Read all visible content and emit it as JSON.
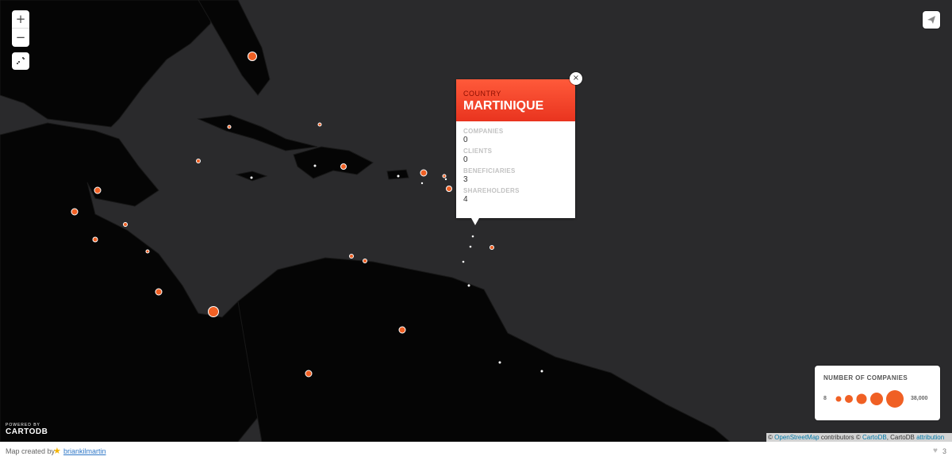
{
  "map": {
    "colors": {
      "ocean": "#2a2a2c",
      "land": "#050505",
      "marker": "#f06024",
      "marker_small": "#ffffff"
    }
  },
  "controls": {
    "zoom_in": "+",
    "zoom_out": "−",
    "fullscreen_icon": "fullscreen-icon",
    "share_icon": "share-icon"
  },
  "popup": {
    "title_label": "COUNTRY",
    "title_value": "MARTINIQUE",
    "close": "×",
    "rows": [
      {
        "label": "COMPANIES",
        "value": "0"
      },
      {
        "label": "CLIENTS",
        "value": "0"
      },
      {
        "label": "BENEFICIARIES",
        "value": "3"
      },
      {
        "label": "SHAREHOLDERS",
        "value": "4"
      }
    ]
  },
  "legend": {
    "title": "NUMBER OF COMPANIES",
    "min": "8",
    "max": "38,000"
  },
  "branding": {
    "powered_by": "POWERED BY",
    "name": "CARTODB"
  },
  "attribution": {
    "copy1": "©",
    "osm": "OpenStreetMap",
    "contrib": "contributors ©",
    "cartodb": "CartoDB",
    "comma": ", CartoDB",
    "attr": "attribution"
  },
  "footer": {
    "created_by": "Map created by",
    "user": "briankilmartin",
    "likes": "3"
  }
}
